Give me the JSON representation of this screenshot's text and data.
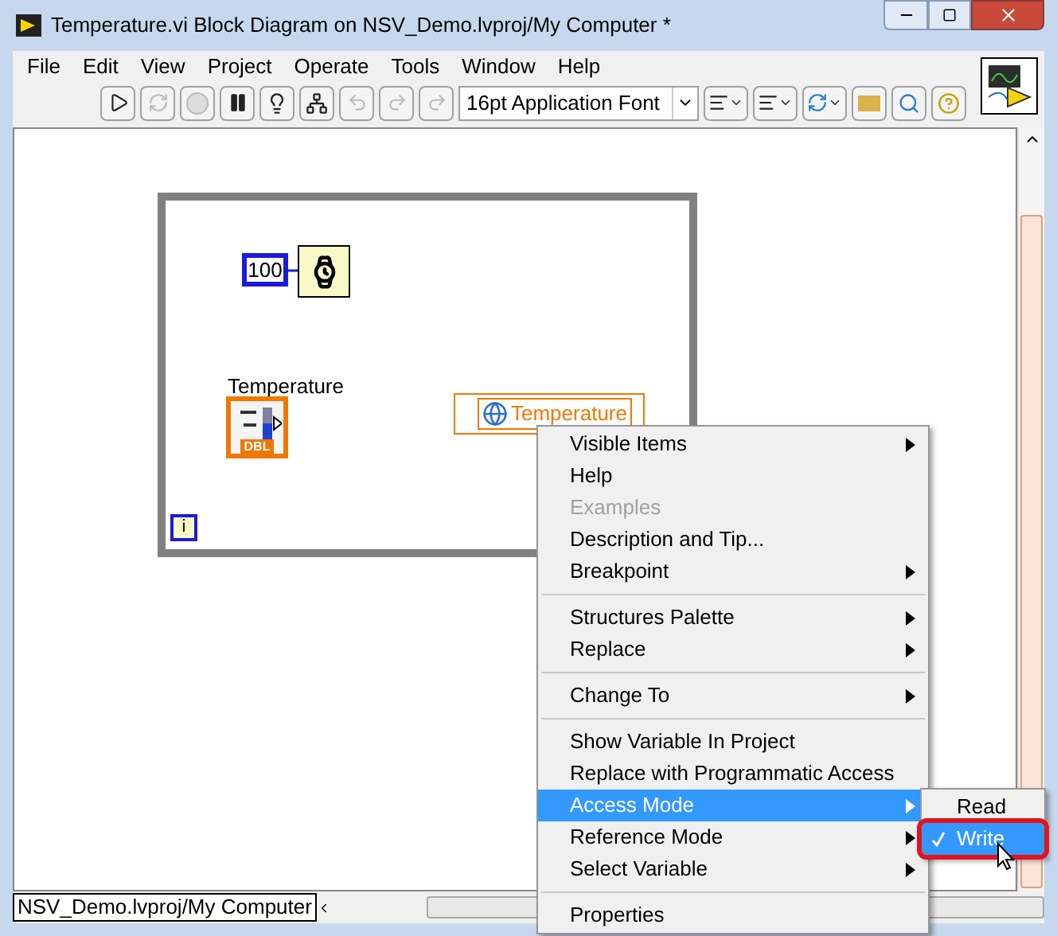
{
  "window": {
    "title": "Temperature.vi Block Diagram on NSV_Demo.lvproj/My Computer *"
  },
  "menu_bar": [
    "File",
    "Edit",
    "View",
    "Project",
    "Operate",
    "Tools",
    "Window",
    "Help"
  ],
  "toolbar": {
    "font_selector": "16pt Application Font"
  },
  "diagram": {
    "constant": "100",
    "indicator_label": "Temperature",
    "indicator_type": "DBL",
    "variable_name": "Temperature",
    "iteration_terminal": "i"
  },
  "context_menu": [
    {
      "kind": "item",
      "label": "Visible Items",
      "submenu": true,
      "disabled": false,
      "selected": false
    },
    {
      "kind": "item",
      "label": "Help",
      "submenu": false,
      "disabled": false,
      "selected": false
    },
    {
      "kind": "item",
      "label": "Examples",
      "submenu": false,
      "disabled": true,
      "selected": false
    },
    {
      "kind": "item",
      "label": "Description and Tip...",
      "submenu": false,
      "disabled": false,
      "selected": false
    },
    {
      "kind": "item",
      "label": "Breakpoint",
      "submenu": true,
      "disabled": false,
      "selected": false
    },
    {
      "kind": "separator"
    },
    {
      "kind": "item",
      "label": "Structures Palette",
      "submenu": true,
      "disabled": false,
      "selected": false
    },
    {
      "kind": "item",
      "label": "Replace",
      "submenu": true,
      "disabled": false,
      "selected": false
    },
    {
      "kind": "separator"
    },
    {
      "kind": "item",
      "label": "Change To",
      "submenu": true,
      "disabled": false,
      "selected": false
    },
    {
      "kind": "separator"
    },
    {
      "kind": "item",
      "label": "Show Variable In Project",
      "submenu": false,
      "disabled": false,
      "selected": false
    },
    {
      "kind": "item",
      "label": "Replace with Programmatic Access",
      "submenu": false,
      "disabled": false,
      "selected": false
    },
    {
      "kind": "item",
      "label": "Access Mode",
      "submenu": true,
      "disabled": false,
      "selected": true
    },
    {
      "kind": "item",
      "label": "Reference Mode",
      "submenu": true,
      "disabled": false,
      "selected": false
    },
    {
      "kind": "item",
      "label": "Select Variable",
      "submenu": true,
      "disabled": false,
      "selected": false
    },
    {
      "kind": "separator"
    },
    {
      "kind": "item",
      "label": "Properties",
      "submenu": false,
      "disabled": false,
      "selected": false
    }
  ],
  "submenu": [
    {
      "label": "Read",
      "checked": false,
      "selected": false
    },
    {
      "label": "Write",
      "checked": true,
      "selected": true
    }
  ],
  "status_bar": "NSV_Demo.lvproj/My Computer"
}
